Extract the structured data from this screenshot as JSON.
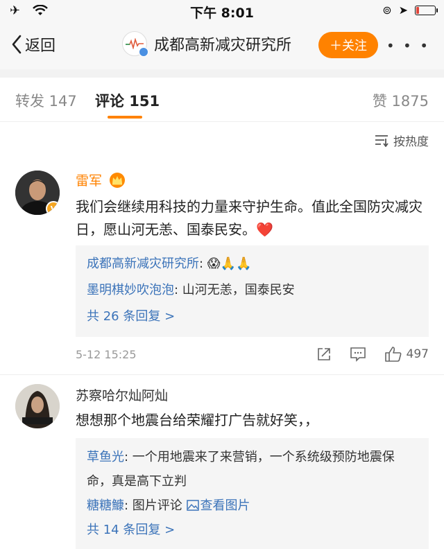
{
  "status_bar": {
    "time": "下午 8:01",
    "battery_level": 0.15
  },
  "nav": {
    "back_label": "返回",
    "title": "成都高新减灾研究所",
    "follow_label": "＋关注",
    "more_label": "• • •"
  },
  "tabs": [
    {
      "label": "转发 147",
      "active": false
    },
    {
      "label": "评论 151",
      "active": true
    },
    {
      "label": "赞 1875",
      "active": false
    }
  ],
  "sort": {
    "label": "按热度"
  },
  "comments": [
    {
      "name": "雷军",
      "name_color": "#ff8200",
      "badge": "crown",
      "text": "我们会继续用科技的力量来守护生命。值此全国防灾减灾日，愿山河无恙、国泰民安。❤️",
      "replies": [
        {
          "name": "成都高新减灾研究所",
          "sep": ":",
          "text": " 😱🙏🙏"
        },
        {
          "name": "墨明棋妙吹泡泡",
          "sep": ":",
          "text": " 山河无恙，国泰民安"
        }
      ],
      "more_replies": "共 26 条回复 >",
      "time": "5-12 15:25",
      "likes": "497"
    },
    {
      "name": "苏察哈尔灿阿灿",
      "name_color": "#333333",
      "text": "想想那个地震台给荣耀打广告就好笑，，",
      "replies": [
        {
          "name": "草鱼光",
          "sep": ":",
          "text": " 一个用地震来了来营销，一个系统级预防地震保命，真是高下立判"
        },
        {
          "name": "糖糖鱇",
          "sep": ":",
          "text": " 图片评论 ",
          "link": "查看图片"
        }
      ],
      "more_replies": "共 14 条回复 >"
    }
  ]
}
